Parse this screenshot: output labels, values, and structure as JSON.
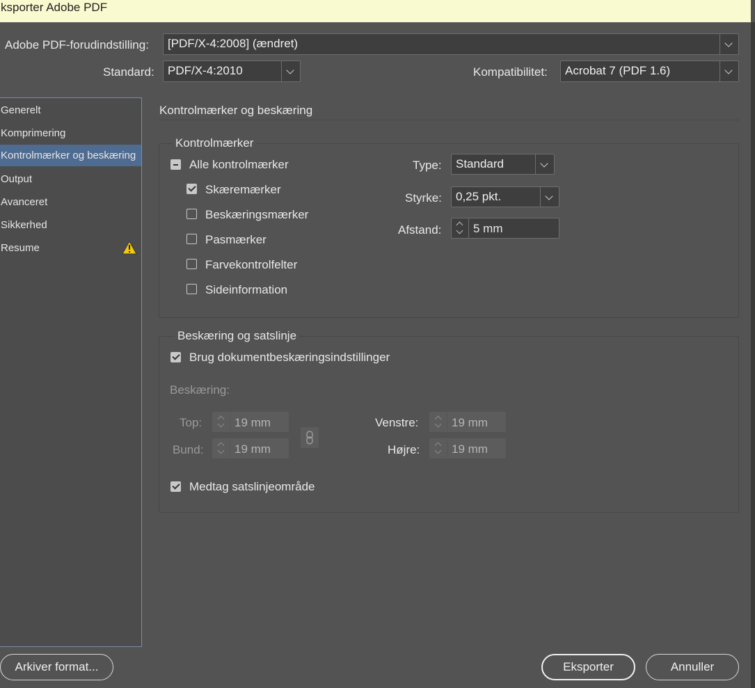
{
  "window": {
    "title": "ksporter Adobe PDF"
  },
  "preset": {
    "label": "Adobe PDF-forudindstilling:",
    "value": "[PDF/X-4:2008] (ændret)"
  },
  "standard": {
    "label": "Standard:",
    "value": "PDF/X-4:2010"
  },
  "compat": {
    "label": "Kompatibilitet:",
    "value": "Acrobat 7 (PDF 1.6)"
  },
  "sidebar": {
    "items": [
      {
        "label": "Generelt"
      },
      {
        "label": "Komprimering"
      },
      {
        "label": "Kontrolmærker og beskæring",
        "selected": true
      },
      {
        "label": "Output"
      },
      {
        "label": "Avanceret"
      },
      {
        "label": "Sikkerhed"
      },
      {
        "label": "Resume",
        "icon": "warning-icon"
      }
    ]
  },
  "main": {
    "heading": "Kontrolmærker og beskæring"
  },
  "marks": {
    "group_title": "Kontrolmærker",
    "all": {
      "label": "Alle kontrolmærker",
      "state": "mixed"
    },
    "items": [
      {
        "label": "Skæremærker",
        "checked": true
      },
      {
        "label": "Beskæringsmærker",
        "checked": false
      },
      {
        "label": "Pasmærker",
        "checked": false
      },
      {
        "label": "Farvekontrolfelter",
        "checked": false
      },
      {
        "label": "Sideinformation",
        "checked": false
      }
    ],
    "type": {
      "label": "Type:",
      "value": "Standard"
    },
    "weight": {
      "label": "Styrke:",
      "value": "0,25 pkt."
    },
    "offset": {
      "label": "Afstand:",
      "value": "5 mm"
    }
  },
  "bleed": {
    "group_title": "Beskæring og satslinje",
    "use_doc": {
      "label": "Brug dokumentbeskæringsindstillinger",
      "checked": true
    },
    "bleed_label": "Beskæring:",
    "top": {
      "label": "Top:",
      "value": "19 mm"
    },
    "bottom": {
      "label": "Bund:",
      "value": "19 mm"
    },
    "left": {
      "label": "Venstre:",
      "value": "19 mm"
    },
    "right": {
      "label": "Højre:",
      "value": "19 mm"
    },
    "slug": {
      "label": "Medtag satslinjeområde",
      "checked": true
    }
  },
  "footer": {
    "save_preset": "Arkiver format...",
    "export": "Eksporter",
    "cancel": "Annuller"
  },
  "colors": {
    "background": "#535353",
    "selection": "#4e6b91",
    "warning": "#f2c811"
  }
}
